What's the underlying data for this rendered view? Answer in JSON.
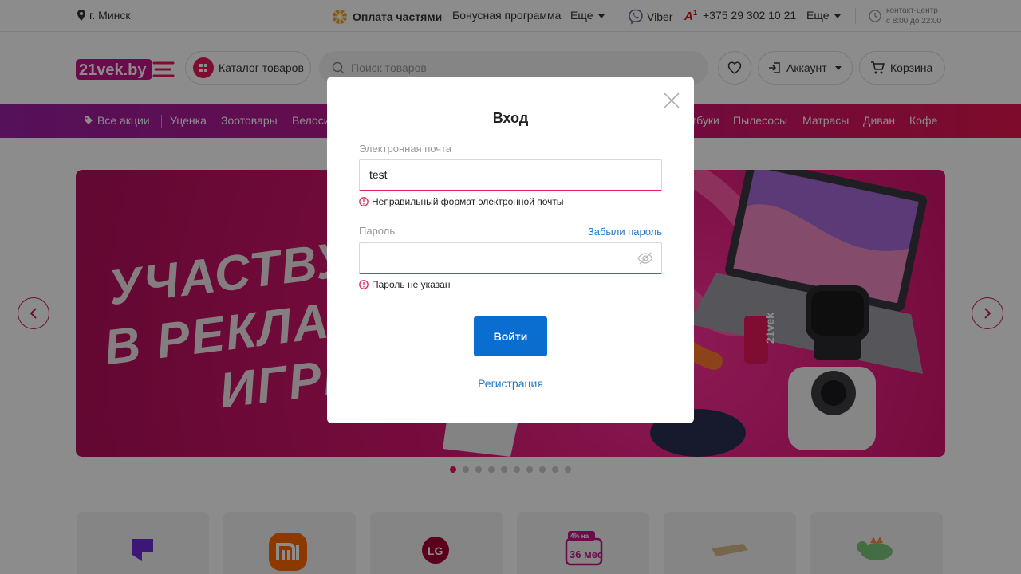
{
  "topbar": {
    "city": "г. Минск",
    "installments": "Оплата частями",
    "bonus": "Бонусная программа",
    "more1": "Еще",
    "viber": "Viber",
    "phone": "+375 29 302 10 21",
    "more2": "Еще",
    "contact_line1": "контакт-центр",
    "contact_line2": "с 8:00 до 22:00"
  },
  "header": {
    "logo_text": "21vek.by",
    "catalog": "Каталог товаров",
    "search_placeholder": "Поиск товаров",
    "account": "Аккаунт",
    "cart": "Корзина"
  },
  "nav": {
    "items": [
      "Все акции",
      "Уценка",
      "Зоотовары",
      "Велосипеды",
      "Ноутбуки",
      "Пылесосы",
      "Матрасы",
      "Диван",
      "Кофе"
    ]
  },
  "banner": {
    "lines": [
      "УЧАСТВУЙ",
      "В РЕКЛАМ",
      "ИГРЕ"
    ],
    "badge": "21vek",
    "dots_total": 10,
    "dots_active": 0
  },
  "brands": {
    "lg_text": "LG",
    "promo_top": "4% на",
    "promo_bottom": "36 мес"
  },
  "modal": {
    "title": "Вход",
    "email_label": "Электронная почта",
    "email_value": "test",
    "email_error": "Неправильный формат электронной почты",
    "password_label": "Пароль",
    "forgot": "Забыли пароль",
    "password_value": "",
    "password_error": "Пароль не указан",
    "submit": "Войти",
    "register": "Регистрация"
  },
  "colors": {
    "accent": "#e6195a",
    "link": "#1e7bcc",
    "button": "#0a6ed1",
    "nav_start": "#9b1fa3",
    "nav_end": "#e5144f"
  }
}
